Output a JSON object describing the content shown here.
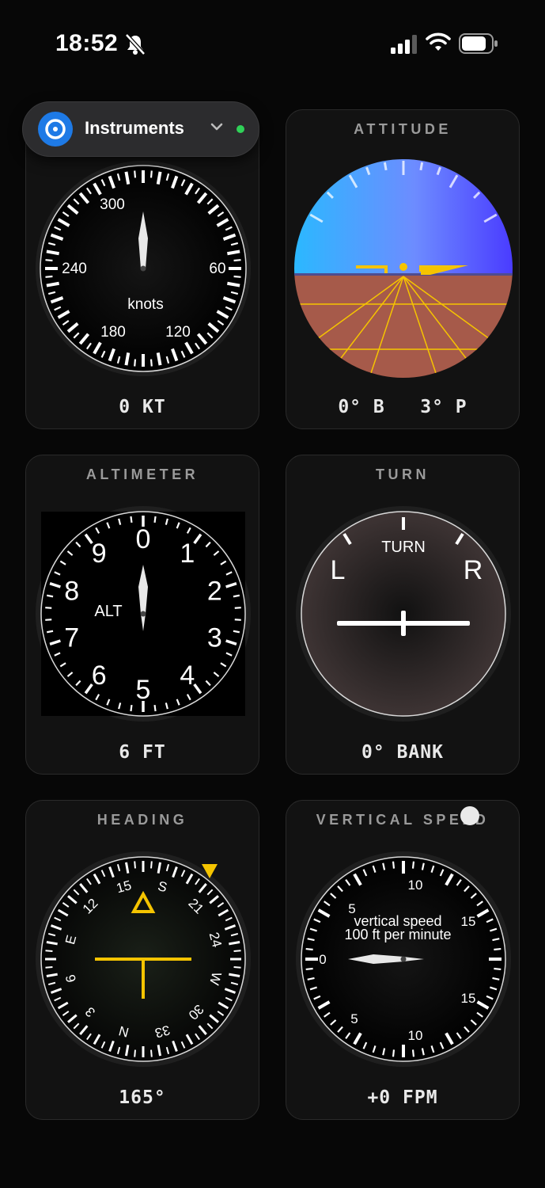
{
  "status_bar": {
    "time": "18:52",
    "icons": [
      "bell-slash-icon",
      "cellular-signal-icon",
      "wifi-icon",
      "battery-icon"
    ]
  },
  "app_switcher": {
    "icon": "compass-icon",
    "name": "Instruments",
    "chevron": "chevron-down-icon",
    "status_color": "#30d158"
  },
  "instruments": {
    "airspeed": {
      "title": "",
      "readout": "0 KT",
      "labels": [
        "300",
        "60",
        "120",
        "180",
        "240"
      ],
      "unit": "knots",
      "value_knots": 0
    },
    "attitude": {
      "title": "ATTITUDE",
      "readout": "0° B   3° P",
      "bank_deg": 0,
      "pitch_deg": 3,
      "sky_colors": [
        "#2bb8ff",
        "#4a3cff"
      ],
      "ground_color": "#a65a4a",
      "marker_color": "#f5c400"
    },
    "altimeter": {
      "title": "ALTIMETER",
      "readout": "6 FT",
      "digits": [
        "0",
        "1",
        "2",
        "3",
        "4",
        "5",
        "6",
        "7",
        "8",
        "9"
      ],
      "label": "ALT",
      "altitude_ft": 6
    },
    "turn": {
      "title": "TURN",
      "readout": "0° BANK",
      "label": "TURN",
      "left": "L",
      "right": "R",
      "bank_deg": 0
    },
    "heading": {
      "title": "HEADING",
      "readout": "165°",
      "labels": [
        "N",
        "3",
        "6",
        "E",
        "12",
        "15",
        "S",
        "21",
        "24",
        "W",
        "30",
        "33"
      ],
      "heading_deg": 165,
      "bug_color": "#f5c400"
    },
    "vertical_speed": {
      "title": "VERTICAL SPEED",
      "readout": "+0 FPM",
      "label_line1": "vertical speed",
      "label_line2": "100 ft per minute",
      "labels": [
        "0",
        "5",
        "10",
        "15",
        "15",
        "10",
        "5"
      ],
      "fpm": 0
    }
  }
}
